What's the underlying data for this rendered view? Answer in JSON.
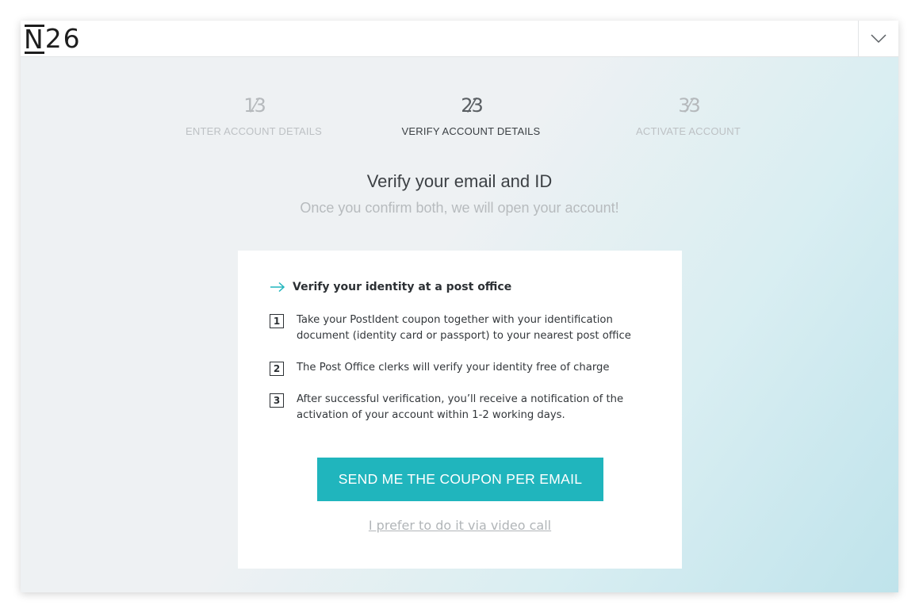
{
  "header": {
    "logo_letter": "N",
    "logo_number": "26",
    "menu_icon": "chevron-down-icon"
  },
  "steps": [
    {
      "fraction": "1⁄3",
      "label": "ENTER ACCOUNT DETAILS",
      "state": "done"
    },
    {
      "fraction": "2⁄3",
      "label": "VERIFY ACCOUNT DETAILS",
      "state": "active"
    },
    {
      "fraction": "3⁄3",
      "label": "ACTIVATE ACCOUNT",
      "state": "upcoming"
    }
  ],
  "main": {
    "title": "Verify your email and ID",
    "subtitle": "Once you confirm both, we will open your account!"
  },
  "card": {
    "title": "Verify your identity at a post office",
    "items": [
      {
        "number": "1",
        "text": "Take your PostIdent coupon together with your identification document (identity card or passport) to your nearest post office"
      },
      {
        "number": "2",
        "text": "The Post Office clerks will verify your identity free of charge"
      },
      {
        "number": "3",
        "text": "After successful verification, you’ll receive a notification of the activation of your account within 1-2 working days."
      }
    ],
    "button_label": "SEND ME THE COUPON PER EMAIL",
    "alt_link_label": "I prefer to do it via video call"
  },
  "colors": {
    "accent": "#20b5bd",
    "text_dark": "#3d4145",
    "text_muted": "#b7bbbe"
  }
}
